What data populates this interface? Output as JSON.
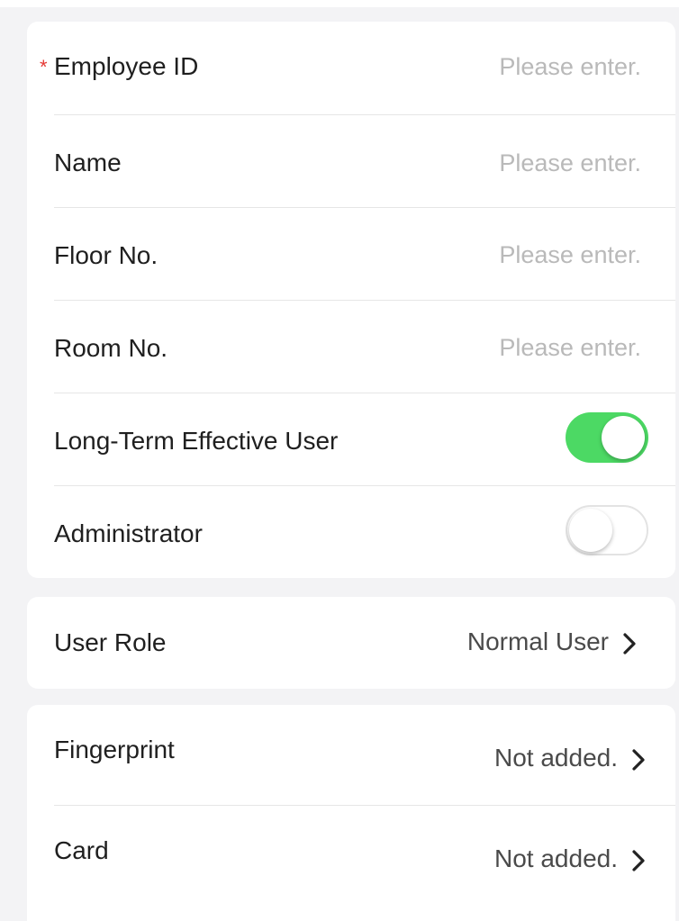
{
  "form": {
    "employee_id": {
      "label": "Employee ID",
      "required_mark": "*",
      "placeholder": "Please enter."
    },
    "name": {
      "label": "Name",
      "placeholder": "Please enter."
    },
    "floor_no": {
      "label": "Floor No.",
      "placeholder": "Please enter."
    },
    "room_no": {
      "label": "Room No.",
      "placeholder": "Please enter."
    },
    "long_term_effective_user": {
      "label": "Long-Term Effective User",
      "enabled": true
    },
    "administrator": {
      "label": "Administrator",
      "enabled": false
    }
  },
  "role": {
    "label": "User Role",
    "value": "Normal User"
  },
  "credentials": {
    "fingerprint": {
      "label": "Fingerprint",
      "value": "Not added."
    },
    "card": {
      "label": "Card",
      "value": "Not added."
    }
  },
  "colors": {
    "toggle_on": "#4cd964",
    "required_mark": "#e53935",
    "placeholder": "#b9b9b9",
    "background": "#f3f3f5"
  },
  "icons": {
    "chevron": "chevron-right-icon"
  }
}
